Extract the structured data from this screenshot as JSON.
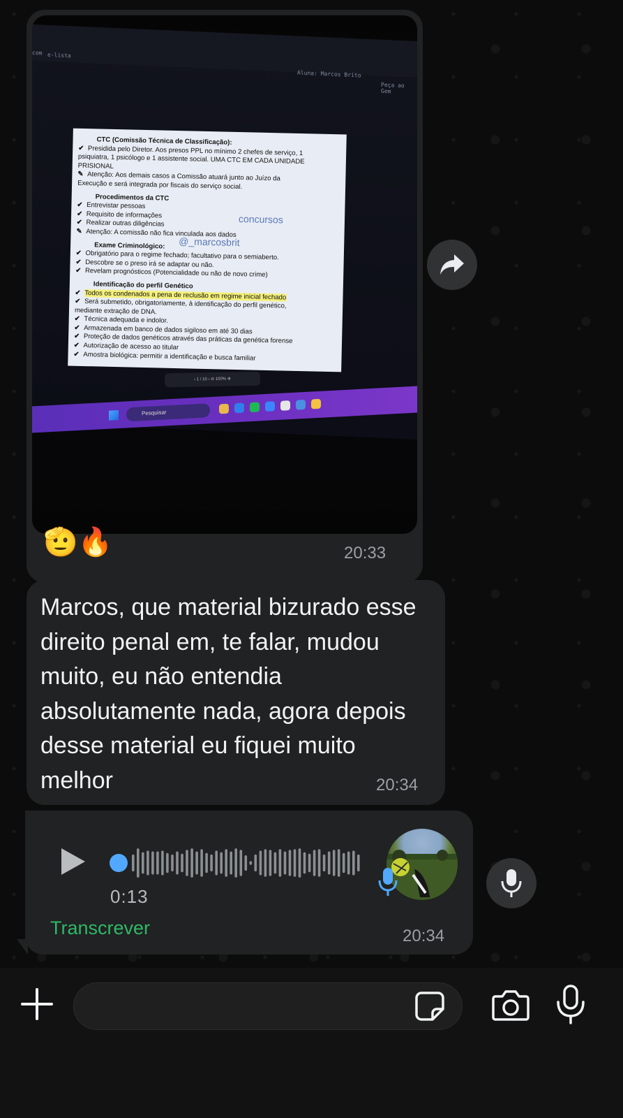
{
  "messages": [
    {
      "type": "image",
      "reactions": "🫡🔥",
      "time": "20:33",
      "photo": {
        "topbar": [
          "com",
          "e-lista",
          "Aluna: Marcos Brito",
          "Peça ao Gem"
        ],
        "document": {
          "lines": [
            {
              "kind": "head",
              "text": "CTC (Comissão Técnica de Classificação):"
            },
            {
              "kind": "check",
              "text": "Presidida pelo Diretor. Aos presos PPL no mínimo 2 chefes de serviço, 1"
            },
            {
              "kind": "plain",
              "text": "psiquiatra, 1 psicólogo e 1 assistente social. UMA CTC EM CADA UNIDADE"
            },
            {
              "kind": "plain",
              "text": "PRISIONAL"
            },
            {
              "kind": "pin",
              "text": "Atenção: Aos demais casos a Comissão atuará junto ao Juízo da"
            },
            {
              "kind": "plain",
              "text": "Execução e será integrada por fiscais do serviço social."
            },
            {
              "kind": "head",
              "text": "Procedimentos da CTC"
            },
            {
              "kind": "check",
              "text": "Entrevistar pessoas"
            },
            {
              "kind": "check",
              "text": "Requisito de informações"
            },
            {
              "kind": "check",
              "text": "Realizar outras diligências"
            },
            {
              "kind": "pin",
              "text": "Atenção: A comissão não fica vinculada aos dados"
            },
            {
              "kind": "head",
              "text": "Exame Criminológico:"
            },
            {
              "kind": "check",
              "text": "Obrigatório para o regime fechado; facultativo para o semiaberto."
            },
            {
              "kind": "check",
              "text": "Descobre se o preso irá se adaptar ou não."
            },
            {
              "kind": "check",
              "text": "Revelam prognósticos (Potencialidade ou não de novo crime)"
            },
            {
              "kind": "head",
              "text": "Identificação do perfil Genético"
            },
            {
              "kind": "checkhl",
              "text": "Todos os condenados a pena de reclusão em regime inicial fechado"
            },
            {
              "kind": "check",
              "text": "Será submetido, obrigatoriamente, à identificação do perfil genético,"
            },
            {
              "kind": "plain",
              "text": "mediante extração de DNA."
            },
            {
              "kind": "check",
              "text": "Técnica adequada e indolor."
            },
            {
              "kind": "check",
              "text": "Armazenada em banco de dados sigiloso em até 30 dias"
            },
            {
              "kind": "check",
              "text": "Proteção de dados genéticos através das práticas da genética forense"
            },
            {
              "kind": "check",
              "text": "Autorização de acesso ao titular"
            },
            {
              "kind": "check",
              "text": "Amostra biológica: permitir a identificação e busca familiar"
            }
          ],
          "watermark_1": "concursos",
          "watermark_2": "@_marcosbrit"
        },
        "pager": "‹  1 / 10  ›    ⊖  100%  ⊕",
        "taskbar_search": "Pesquisar"
      }
    },
    {
      "type": "text",
      "text": "Marcos, que material bizurado esse direito penal em, te falar, mudou muito, eu não entendia absolutamente nada, agora depois desse material eu fiquei muito melhor",
      "time": "20:34"
    },
    {
      "type": "voice",
      "duration": "0:13",
      "transcribe_label": "Transcrever",
      "time": "20:34",
      "waveform": [
        0.55,
        0.95,
        0.7,
        0.8,
        0.75,
        0.75,
        0.8,
        0.65,
        0.55,
        0.75,
        0.6,
        0.85,
        0.95,
        0.75,
        0.9,
        0.65,
        0.55,
        0.8,
        0.7,
        0.9,
        0.75,
        0.95,
        0.85,
        0.5,
        0.12,
        0.55,
        0.8,
        0.9,
        0.85,
        0.7,
        0.9,
        0.75,
        0.85,
        0.9,
        0.95,
        0.7,
        0.6,
        0.85,
        0.9,
        0.55,
        0.75,
        0.85,
        0.9,
        0.65,
        0.75,
        0.8,
        0.55
      ]
    }
  ],
  "composer": {
    "placeholder": ""
  },
  "colors": {
    "bubble": "#202223",
    "accent_green": "#2fb866",
    "accent_blue": "#52a8ff"
  }
}
